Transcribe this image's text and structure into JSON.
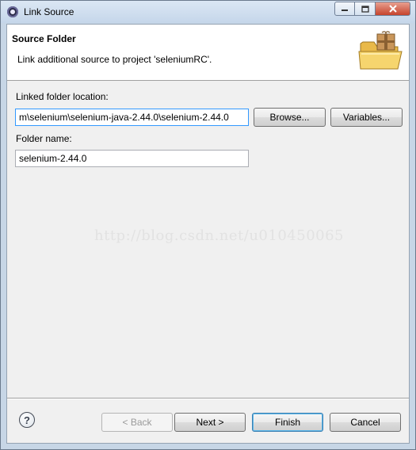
{
  "window": {
    "title": "Link Source",
    "controls": {
      "minimize": "▭",
      "maximize": "□",
      "close": "✕"
    }
  },
  "header": {
    "title": "Source Folder",
    "description": "Link additional source to project 'seleniumRC'.",
    "icon": "folder-package-icon"
  },
  "form": {
    "linked_folder_label": "Linked folder location:",
    "linked_folder_value": "m\\selenium\\selenium-java-2.44.0\\selenium-2.44.0",
    "browse_label": "Browse...",
    "variables_label": "Variables...",
    "folder_name_label": "Folder name:",
    "folder_name_value": "selenium-2.44.0"
  },
  "watermark": "http://blog.csdn.net/u010450065",
  "footer": {
    "help_icon": "help-icon",
    "help_glyph": "?",
    "back_label": "< Back",
    "next_label": "Next >",
    "finish_label": "Finish",
    "cancel_label": "Cancel"
  }
}
